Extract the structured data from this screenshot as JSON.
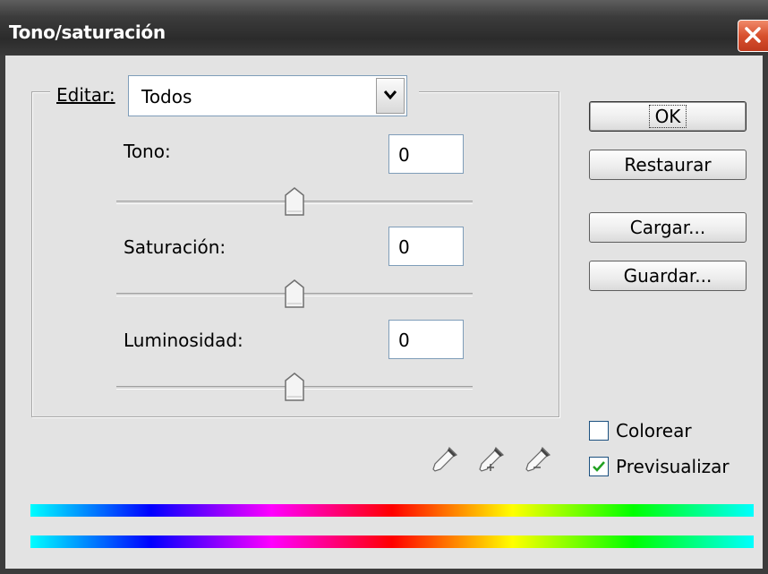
{
  "window": {
    "title": "Tono/saturación"
  },
  "edit": {
    "label": "Editar:",
    "selected": "Todos"
  },
  "sliders": [
    {
      "label": "Tono:",
      "value": "0",
      "position": 0.5
    },
    {
      "label": "Saturación:",
      "value": "0",
      "position": 0.5
    },
    {
      "label": "Luminosidad:",
      "value": "0",
      "position": 0.5
    }
  ],
  "buttons": {
    "ok": "OK",
    "restore": "Restaurar",
    "load": "Cargar...",
    "save": "Guardar..."
  },
  "options": {
    "colorize": {
      "label": "Colorear",
      "checked": false
    },
    "preview": {
      "label": "Previsualizar",
      "checked": true
    }
  },
  "icons": [
    "eyedropper-icon",
    "eyedropper-plus-icon",
    "eyedropper-minus-icon"
  ],
  "colors": {
    "titlebar": "#3c3c3c",
    "close": "#d8502e",
    "background": "#e3e3e3"
  }
}
